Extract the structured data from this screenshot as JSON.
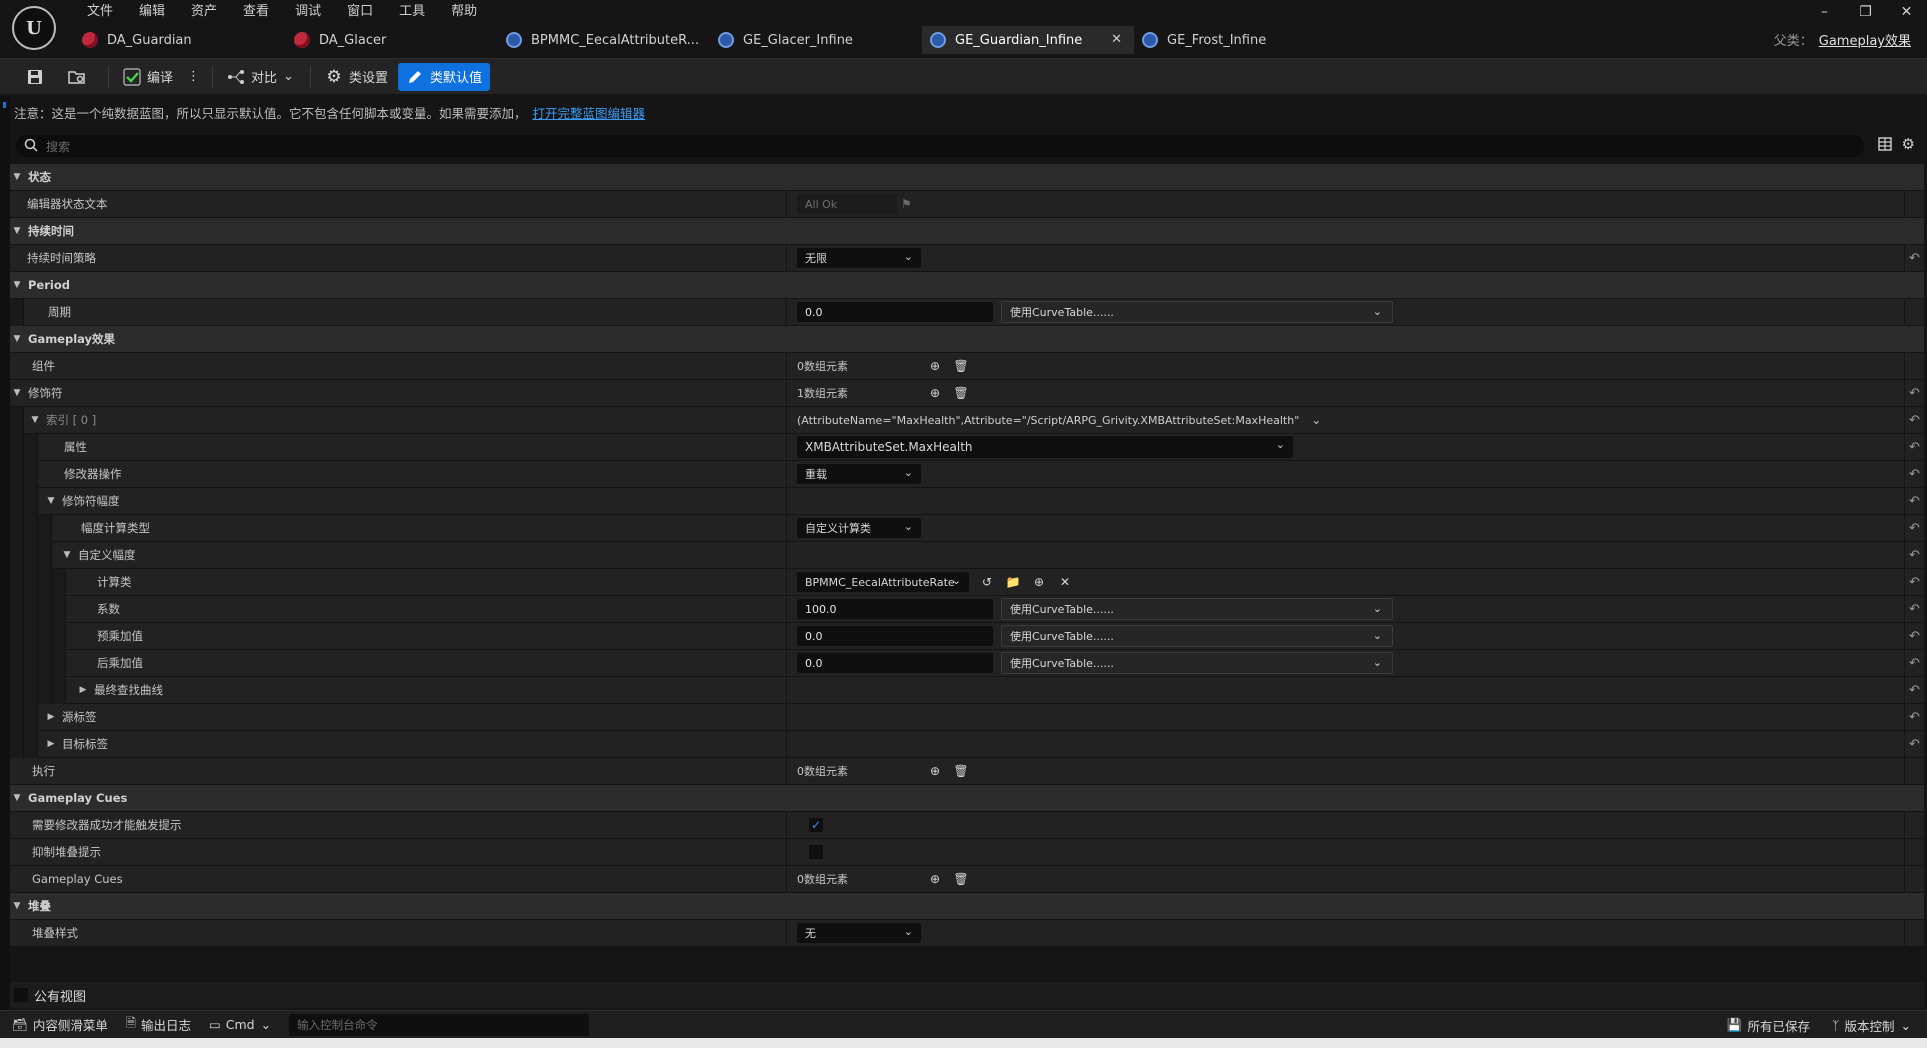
{
  "menu": [
    "文件",
    "编辑",
    "资产",
    "查看",
    "调试",
    "窗口",
    "工具",
    "帮助"
  ],
  "tabs": [
    {
      "label": "DA_Guardian",
      "icon": "red"
    },
    {
      "label": "DA_Glacer",
      "icon": "red"
    },
    {
      "label": "BPMMC_EecalAttributeR...",
      "icon": "blue"
    },
    {
      "label": "GE_Glacer_Infine",
      "icon": "blue"
    },
    {
      "label": "GE_Guardian_Infine",
      "icon": "blue",
      "active": true
    },
    {
      "label": "GE_Frost_Infine",
      "icon": "blue"
    }
  ],
  "parent_class": {
    "label": "父类：",
    "value": "Gameplay效果"
  },
  "toolbar": {
    "compile": "编译",
    "diff": "对比",
    "class_settings": "类设置",
    "class_defaults": "类默认值"
  },
  "notice": {
    "text": "注意：这是一个纯数据蓝图，所以只显示默认值。它不包含任何脚本或变量。如果需要添加，",
    "link": "打开完整蓝图编辑器"
  },
  "search": {
    "placeholder": "搜索"
  },
  "rows": [
    {
      "kind": "cat",
      "label": "状态"
    },
    {
      "kind": "prop",
      "label": "编辑器状态文本",
      "readonly": "All Ok"
    },
    {
      "kind": "cat",
      "label": "持续时间"
    },
    {
      "kind": "prop",
      "label": "持续时间策略",
      "combo": "无限"
    },
    {
      "kind": "cat",
      "label": "Period"
    },
    {
      "kind": "prop",
      "label": "周期",
      "num": "0.0",
      "curve": "使用CurveTable......"
    },
    {
      "kind": "cat",
      "label": "Gameplay效果"
    },
    {
      "kind": "prop",
      "label": "组件",
      "arr": "0数组元素"
    },
    {
      "kind": "cat",
      "label": "修饰符",
      "arr": "1数组元素"
    },
    {
      "kind": "prop",
      "label": "索引 [ 0 ]",
      "long": "(AttributeName=\"MaxHealth\",Attribute=\"/Script/ARPG_Grivity.XMBAttributeSet:MaxHealth\""
    },
    {
      "kind": "prop",
      "label": "属性",
      "combo": "XMBAttributeSet.MaxHealth"
    },
    {
      "kind": "prop",
      "label": "修改器操作",
      "combo": "重载"
    },
    {
      "kind": "prop",
      "label": "修饰符幅度"
    },
    {
      "kind": "prop",
      "label": "幅度计算类型",
      "combo": "自定义计算类"
    },
    {
      "kind": "prop",
      "label": "自定义幅度"
    },
    {
      "kind": "prop",
      "label": "计算类",
      "combo": "BPMMC_EecalAttributeRate"
    },
    {
      "kind": "prop",
      "label": "系数",
      "num": "100.0",
      "curve": "使用CurveTable......"
    },
    {
      "kind": "prop",
      "label": "预乘加值",
      "num": "0.0",
      "curve": "使用CurveTable......"
    },
    {
      "kind": "prop",
      "label": "后乘加值",
      "num": "0.0",
      "curve": "使用CurveTable......"
    },
    {
      "kind": "prop",
      "label": "最终查找曲线"
    },
    {
      "kind": "prop",
      "label": "源标签"
    },
    {
      "kind": "prop",
      "label": "目标标签"
    },
    {
      "kind": "prop",
      "label": "执行",
      "arr": "0数组元素"
    },
    {
      "kind": "cat",
      "label": "Gameplay Cues"
    },
    {
      "kind": "prop",
      "label": "需要修改器成功才能触发提示",
      "checked": true
    },
    {
      "kind": "prop",
      "label": "抑制堆叠提示",
      "checked": false
    },
    {
      "kind": "prop",
      "label": "Gameplay Cues",
      "arr": "0数组元素"
    },
    {
      "kind": "cat",
      "label": "堆叠"
    },
    {
      "kind": "prop",
      "label": "堆叠样式",
      "combo": "无"
    }
  ],
  "public_view": "公有视图",
  "status": {
    "content_drawer": "内容侧滑菜单",
    "output_log": "输出日志",
    "cmd": "Cmd",
    "console_placeholder": "输入控制台命令",
    "all_saved": "所有已保存",
    "source_control": "版本控制"
  }
}
